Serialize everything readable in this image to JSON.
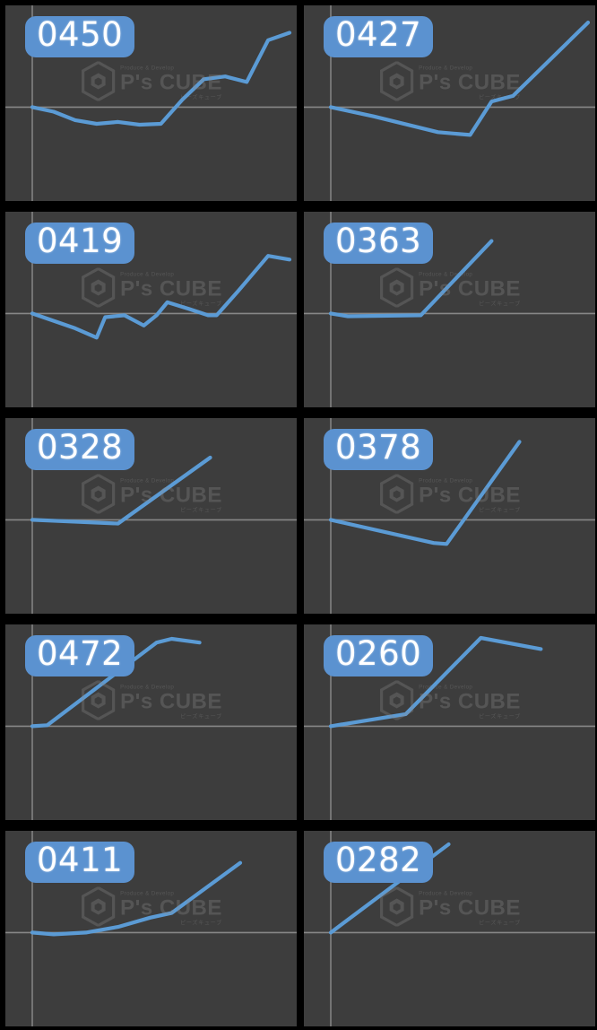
{
  "layout": {
    "columns": 2,
    "rows": 5,
    "panel_count": 10,
    "background_color": "#000000",
    "panel_background_color": "#3d3d3d"
  },
  "theme": {
    "badge_bg": "#5b92d0",
    "badge_text": "#ffffff",
    "line_color": "#5b9bd5",
    "axis_color": "#9a9a9a",
    "watermark_color": "#8d8d8d"
  },
  "watermark": {
    "logo_icon": "hexagon-cube-logo-icon",
    "top_text": "Produce & Develop",
    "main_text": "P's CUBE",
    "bottom_text": "ピーズキューブ"
  },
  "chart_data": [
    {
      "type": "line",
      "title": "0450",
      "xlabel": "",
      "ylabel": "",
      "grid": true,
      "legend": false,
      "baseline_y": 0,
      "xlim": [
        0,
        12
      ],
      "ylim": [
        -100,
        100
      ],
      "x": [
        0,
        1,
        2,
        3,
        4,
        5,
        6,
        7,
        8,
        9,
        10,
        11,
        12
      ],
      "values": [
        0,
        -5,
        -14,
        -18,
        -16,
        -19,
        -18,
        8,
        30,
        33,
        27,
        72,
        80
      ]
    },
    {
      "type": "line",
      "title": "0427",
      "xlabel": "",
      "ylabel": "",
      "grid": true,
      "legend": false,
      "baseline_y": 0,
      "xlim": [
        0,
        12
      ],
      "ylim": [
        -100,
        100
      ],
      "x": [
        0,
        2,
        5,
        6.5,
        7.5,
        8.5,
        12
      ],
      "values": [
        0,
        -10,
        -27,
        -30,
        6,
        12,
        91
      ]
    },
    {
      "type": "line",
      "title": "0419",
      "xlabel": "",
      "ylabel": "",
      "grid": true,
      "legend": false,
      "baseline_y": 0,
      "xlim": [
        0,
        12
      ],
      "ylim": [
        -100,
        100
      ],
      "x": [
        0,
        1,
        2,
        3,
        3.4,
        4.3,
        5.2,
        5.8,
        6.3,
        7.3,
        8.2,
        8.6,
        9.6,
        11,
        12
      ],
      "values": [
        0,
        -8,
        -16,
        -26,
        -4,
        -2,
        -13,
        -2,
        12,
        5,
        -2,
        -2,
        24,
        62,
        58
      ]
    },
    {
      "type": "line",
      "title": "0363",
      "xlabel": "",
      "ylabel": "",
      "grid": true,
      "legend": false,
      "baseline_y": 0,
      "xlim": [
        0,
        12
      ],
      "ylim": [
        -100,
        100
      ],
      "x": [
        0,
        0.8,
        4.2,
        7.5
      ],
      "values": [
        0,
        -3,
        -2,
        78
      ]
    },
    {
      "type": "line",
      "title": "0328",
      "xlabel": "",
      "ylabel": "",
      "grid": true,
      "legend": false,
      "baseline_y": 0,
      "xlim": [
        0,
        12
      ],
      "ylim": [
        -100,
        100
      ],
      "x": [
        0,
        4,
        8.3
      ],
      "values": [
        0,
        -4,
        67
      ]
    },
    {
      "type": "line",
      "title": "0378",
      "xlabel": "",
      "ylabel": "",
      "grid": true,
      "legend": false,
      "baseline_y": 0,
      "xlim": [
        0,
        12
      ],
      "ylim": [
        -100,
        100
      ],
      "x": [
        0,
        4.8,
        5.4,
        8.8
      ],
      "values": [
        0,
        -25,
        -26,
        84
      ]
    },
    {
      "type": "line",
      "title": "0472",
      "xlabel": "",
      "ylabel": "",
      "grid": true,
      "legend": false,
      "baseline_y": 0,
      "xlim": [
        0,
        12
      ],
      "ylim": [
        -100,
        100
      ],
      "x": [
        0,
        0.7,
        5.8,
        6.5,
        7.8
      ],
      "values": [
        0,
        1,
        90,
        94,
        90
      ]
    },
    {
      "type": "line",
      "title": "0260",
      "xlabel": "",
      "ylabel": "",
      "grid": true,
      "legend": false,
      "baseline_y": 0,
      "xlim": [
        0,
        12
      ],
      "ylim": [
        -100,
        100
      ],
      "x": [
        0,
        3.5,
        7,
        9.8
      ],
      "values": [
        0,
        13,
        95,
        83
      ]
    },
    {
      "type": "line",
      "title": "0411",
      "xlabel": "",
      "ylabel": "",
      "grid": true,
      "legend": false,
      "baseline_y": 0,
      "xlim": [
        0,
        12
      ],
      "ylim": [
        -100,
        100
      ],
      "x": [
        0,
        1,
        2.5,
        4,
        5.5,
        6.5,
        9.7
      ],
      "values": [
        0,
        -2,
        0,
        6,
        16,
        21,
        75
      ]
    },
    {
      "type": "line",
      "title": "0282",
      "xlabel": "",
      "ylabel": "",
      "grid": true,
      "legend": false,
      "baseline_y": 0,
      "xlim": [
        0,
        12
      ],
      "ylim": [
        -100,
        100
      ],
      "x": [
        0,
        5.5
      ],
      "values": [
        0,
        95
      ]
    }
  ]
}
